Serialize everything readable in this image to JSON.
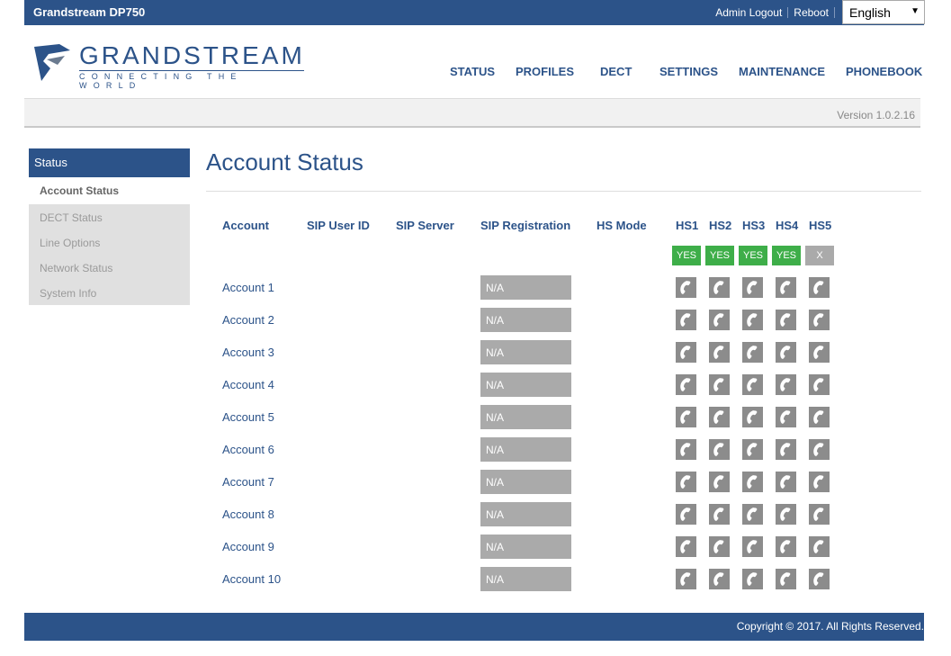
{
  "header": {
    "app_title": "Grandstream DP750",
    "links": [
      "Admin Logout",
      "Reboot"
    ],
    "language": "English"
  },
  "logo": {
    "wordmark": "GRANDSTREAM",
    "tagline": "CONNECTING THE WORLD"
  },
  "nav": {
    "items": [
      "STATUS",
      "PROFILES",
      "DECT",
      "SETTINGS",
      "MAINTENANCE",
      "PHONEBOOK"
    ]
  },
  "version": "Version 1.0.2.16",
  "sidebar": {
    "header": "Status",
    "items": [
      "Account Status",
      "DECT Status",
      "Line Options",
      "Network Status",
      "System Info"
    ],
    "active": "Account Status"
  },
  "page": {
    "title": "Account Status"
  },
  "table": {
    "columns": [
      "Account",
      "SIP User ID",
      "SIP Server",
      "SIP Registration",
      "HS Mode",
      "HS1",
      "HS2",
      "HS3",
      "HS4",
      "HS5"
    ],
    "hs_status": [
      "YES",
      "YES",
      "YES",
      "YES",
      "X"
    ],
    "rows": [
      {
        "account": "Account 1",
        "sip_user_id": "",
        "sip_server": "",
        "sip_registration": "N/A",
        "hs_mode": ""
      },
      {
        "account": "Account 2",
        "sip_user_id": "",
        "sip_server": "",
        "sip_registration": "N/A",
        "hs_mode": ""
      },
      {
        "account": "Account 3",
        "sip_user_id": "",
        "sip_server": "",
        "sip_registration": "N/A",
        "hs_mode": ""
      },
      {
        "account": "Account 4",
        "sip_user_id": "",
        "sip_server": "",
        "sip_registration": "N/A",
        "hs_mode": ""
      },
      {
        "account": "Account 5",
        "sip_user_id": "",
        "sip_server": "",
        "sip_registration": "N/A",
        "hs_mode": ""
      },
      {
        "account": "Account 6",
        "sip_user_id": "",
        "sip_server": "",
        "sip_registration": "N/A",
        "hs_mode": ""
      },
      {
        "account": "Account 7",
        "sip_user_id": "",
        "sip_server": "",
        "sip_registration": "N/A",
        "hs_mode": ""
      },
      {
        "account": "Account 8",
        "sip_user_id": "",
        "sip_server": "",
        "sip_registration": "N/A",
        "hs_mode": ""
      },
      {
        "account": "Account 9",
        "sip_user_id": "",
        "sip_server": "",
        "sip_registration": "N/A",
        "hs_mode": ""
      },
      {
        "account": "Account 10",
        "sip_user_id": "",
        "sip_server": "",
        "sip_registration": "N/A",
        "hs_mode": ""
      }
    ],
    "handset_icon": "phone-handset-icon"
  },
  "footer": {
    "copyright": "Copyright © 2017. All Rights Reserved."
  },
  "colors": {
    "brand": "#2c5389",
    "yes": "#3eae49",
    "inactive": "#aaaaaa"
  }
}
